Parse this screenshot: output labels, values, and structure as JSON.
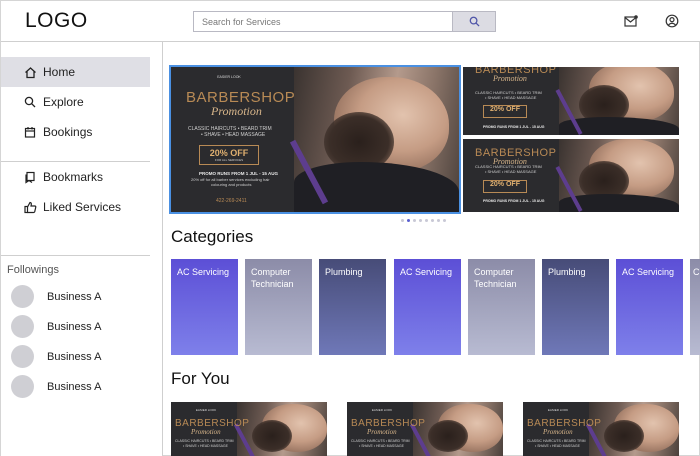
{
  "header": {
    "logo": "LOGO",
    "search_placeholder": "Search for Services",
    "search_icon": "search-icon",
    "mail_icon": "mail-icon",
    "account_icon": "account-icon"
  },
  "sidebar": {
    "items": [
      {
        "label": "Home",
        "icon": "home-icon"
      },
      {
        "label": "Explore",
        "icon": "search-icon"
      },
      {
        "label": "Bookings",
        "icon": "calendar-icon"
      },
      {
        "label": "Bookmarks",
        "icon": "bookmark-icon"
      },
      {
        "label": "Liked Services",
        "icon": "thumbs-up-icon"
      }
    ],
    "followings_title": "Followings",
    "followings": [
      "Business A",
      "Business A",
      "Business A",
      "Business A"
    ]
  },
  "banner": {
    "crest": "EASIER LOOK",
    "brand": "BARBERSHOP",
    "script": "Promotion",
    "line1": "CLASSIC HAIRCUTS • BEARD TRIM",
    "line2": "• SHAVE • HEAD MASSAGE",
    "offer": "20% OFF",
    "offer_sub": "FOR ALL SERVICES",
    "promo": "PROMO RUNS FROM 1 JUL - 15 AUG",
    "fine1": "20% off for all barber services excluding hair",
    "fine2": "colouring and products",
    "phone": "422-269-2411"
  },
  "carousel": {
    "count": 8,
    "active": 1
  },
  "categories": {
    "title": "Categories",
    "items": [
      "AC Servicing",
      "Computer Technician",
      "Plumbing",
      "AC Servicing",
      "Computer Technician",
      "Plumbing",
      "AC Servicing",
      "C"
    ]
  },
  "for_you": {
    "title": "For You"
  },
  "colors": {
    "accent": "#5a5fd0",
    "banner_bg": "#2b2b2e",
    "brand_gold": "#b88a55",
    "selected_border": "#4a90e2"
  }
}
